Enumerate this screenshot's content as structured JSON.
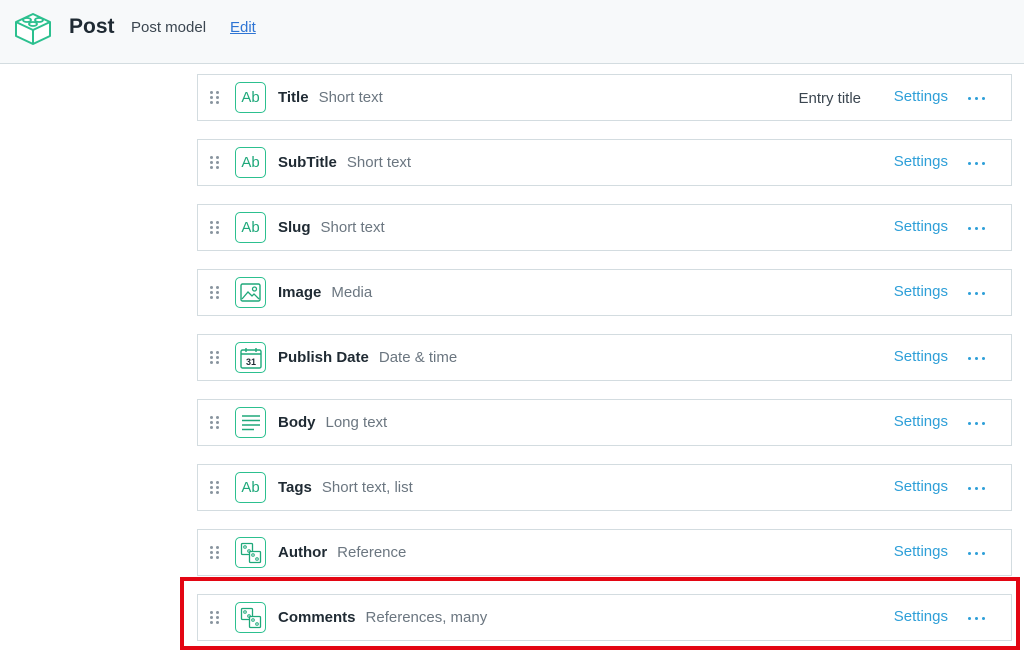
{
  "header": {
    "title": "Post",
    "subtitle": "Post model",
    "edit_label": "Edit",
    "icon": "content-model-icon"
  },
  "fields": [
    {
      "name": "Title",
      "type": "Short text",
      "icon": "text-field-icon",
      "icon_text": "Ab",
      "entry_title": "Entry title",
      "settings": "Settings"
    },
    {
      "name": "SubTitle",
      "type": "Short text",
      "icon": "text-field-icon",
      "icon_text": "Ab",
      "settings": "Settings"
    },
    {
      "name": "Slug",
      "type": "Short text",
      "icon": "text-field-icon",
      "icon_text": "Ab",
      "settings": "Settings"
    },
    {
      "name": "Image",
      "type": "Media",
      "icon": "media-icon",
      "settings": "Settings"
    },
    {
      "name": "Publish Date",
      "type": "Date & time",
      "icon": "calendar-icon",
      "icon_text": "31",
      "settings": "Settings"
    },
    {
      "name": "Body",
      "type": "Long text",
      "icon": "long-text-icon",
      "settings": "Settings"
    },
    {
      "name": "Tags",
      "type": "Short text, list",
      "icon": "text-field-icon",
      "icon_text": "Ab",
      "settings": "Settings"
    },
    {
      "name": "Author",
      "type": "Reference",
      "icon": "reference-icon",
      "settings": "Settings"
    },
    {
      "name": "Comments",
      "type": "References, many",
      "icon": "reference-icon",
      "settings": "Settings",
      "highlighted": true
    }
  ],
  "colors": {
    "accent_green": "#2cc08f",
    "link_blue": "#2e9fd8",
    "edit_blue": "#2e75d4",
    "highlight_red": "#e30613"
  }
}
